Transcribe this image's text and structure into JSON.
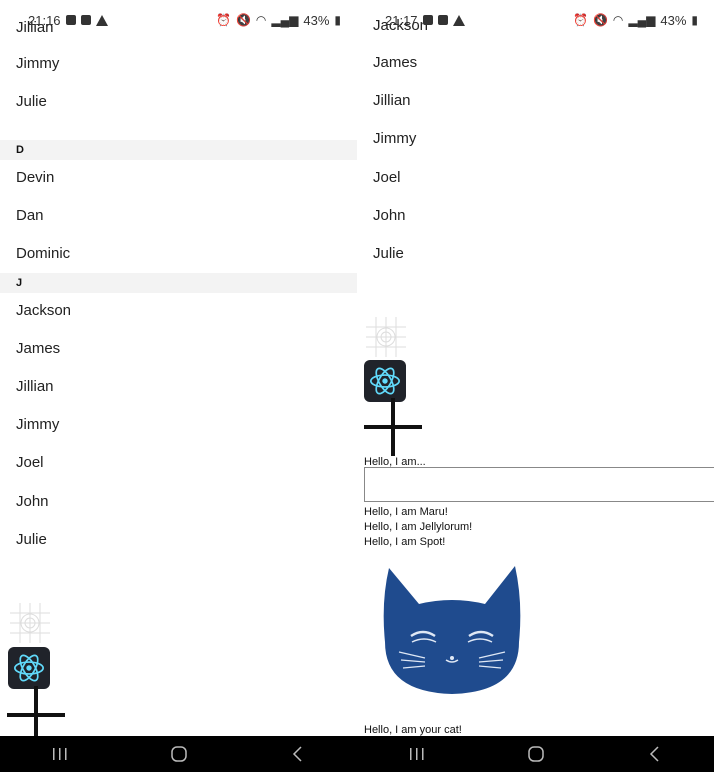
{
  "left": {
    "status": {
      "time": "21:16",
      "battery": "43%"
    },
    "items_top": [
      "Jillian",
      "Jimmy",
      "Julie"
    ],
    "sections": [
      {
        "header": "D",
        "items": [
          "Devin",
          "Dan",
          "Dominic"
        ]
      },
      {
        "header": "J",
        "items": [
          "Jackson",
          "James",
          "Jillian",
          "Jimmy",
          "Joel",
          "John",
          "Julie"
        ]
      }
    ]
  },
  "right": {
    "status": {
      "time": "21:17",
      "battery": "43%"
    },
    "items": [
      "Jackson",
      "James",
      "Jillian",
      "Jimmy",
      "Joel",
      "John",
      "Julie"
    ],
    "hello_prompt": "Hello, I am...",
    "greetings": [
      "Hello, I am Maru!",
      "Hello, I am Jellylorum!",
      "Hello, I am Spot!"
    ],
    "cat_caption": "Hello, I am your cat!"
  },
  "icons": {
    "alarm": "alarm-icon",
    "mute": "mute-icon",
    "wifi": "wifi-icon",
    "signal": "signal-icon",
    "battery": "battery-icon",
    "react": "react-logo-icon"
  },
  "colors": {
    "section_header_bg": "#f3f3f3",
    "react_bg": "#20232a",
    "react_accent": "#61dafb",
    "cat_blue": "#1f4b8e"
  }
}
